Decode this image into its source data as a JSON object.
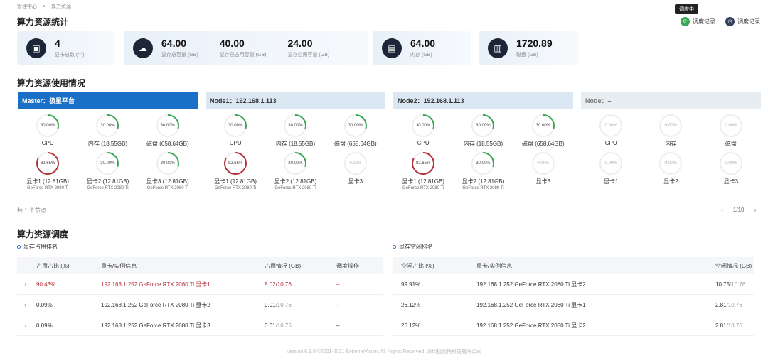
{
  "breadcrumb": [
    "管理中心",
    ">",
    "算力资源"
  ],
  "page_title": "算力资源统计",
  "tooltip": "调度中",
  "header_buttons": {
    "schedule_log_1": "调度记录",
    "schedule_log_2": "调度记录"
  },
  "stats": {
    "gpu_total": {
      "value": "4",
      "label": "显卡总数 (个)"
    },
    "mem_total": {
      "value": "64.00",
      "label": "显存总容量 (GB)"
    },
    "mem_used": {
      "value": "40.00",
      "label": "显存已占用容量 (GB)"
    },
    "mem_free": {
      "value": "24.00",
      "label": "显存空闲容量 (GB)"
    },
    "ram": {
      "value": "64.00",
      "label": "内存 (GB)"
    },
    "disk": {
      "value": "1720.89",
      "label": "磁盘 (GB)"
    }
  },
  "usage_title": "算力资源使用情况",
  "nodes": [
    {
      "title": "Master：极星平台",
      "state": "active",
      "gauges": [
        {
          "pct": 30,
          "text": "30.00%",
          "label": "CPU",
          "sub": ""
        },
        {
          "pct": 30,
          "text": "30.00%",
          "label": "内存 (18.55GB)",
          "sub": ""
        },
        {
          "pct": 30,
          "text": "30.00%",
          "label": "磁盘 (658.64GB)",
          "sub": ""
        },
        {
          "pct": 82.65,
          "text": "82.65%",
          "label": "显卡1 (12.81GB)",
          "sub": "GeForce RTX 2080 Ti"
        },
        {
          "pct": 30,
          "text": "30.00%",
          "label": "显卡2 (12.81GB)",
          "sub": "GeForce RTX 2080 Ti"
        },
        {
          "pct": 30,
          "text": "30.00%",
          "label": "显卡3 (12.81GB)",
          "sub": "GeForce RTX 2080 Ti"
        }
      ]
    },
    {
      "title": "Node1：192.168.1.113",
      "state": "normal",
      "gauges": [
        {
          "pct": 30,
          "text": "30.00%",
          "label": "CPU",
          "sub": ""
        },
        {
          "pct": 30,
          "text": "30.00%",
          "label": "内存 (18.55GB)",
          "sub": ""
        },
        {
          "pct": 30,
          "text": "30.00%",
          "label": "磁盘 (658.64GB)",
          "sub": ""
        },
        {
          "pct": 82.65,
          "text": "82.65%",
          "label": "显卡1 (12.81GB)",
          "sub": "GeForce RTX 2080 Ti"
        },
        {
          "pct": 30,
          "text": "30.00%",
          "label": "显卡2 (12.81GB)",
          "sub": "GeForce RTX 2080 Ti"
        },
        {
          "pct": 0,
          "text": "0.00%",
          "label": "显卡3",
          "sub": ""
        }
      ]
    },
    {
      "title": "Node2：192.168.1.113",
      "state": "normal",
      "gauges": [
        {
          "pct": 30,
          "text": "30.00%",
          "label": "CPU",
          "sub": ""
        },
        {
          "pct": 30,
          "text": "30.00%",
          "label": "内存 (18.55GB)",
          "sub": ""
        },
        {
          "pct": 30,
          "text": "30.00%",
          "label": "磁盘 (658.64GB)",
          "sub": ""
        },
        {
          "pct": 82.65,
          "text": "82.65%",
          "label": "显卡1 (12.81GB)",
          "sub": "GeForce RTX 2080 Ti"
        },
        {
          "pct": 30,
          "text": "30.00%",
          "label": "显卡2 (12.81GB)",
          "sub": "GeForce RTX 2080 Ti"
        },
        {
          "pct": 0,
          "text": "0.00%",
          "label": "显卡3",
          "sub": ""
        }
      ]
    },
    {
      "title": "Node：–",
      "state": "muted",
      "gauges": [
        {
          "pct": 0,
          "text": "0.00%",
          "label": "CPU",
          "sub": ""
        },
        {
          "pct": 0,
          "text": "0.00%",
          "label": "内存",
          "sub": ""
        },
        {
          "pct": 0,
          "text": "0.00%",
          "label": "磁盘",
          "sub": ""
        },
        {
          "pct": 0,
          "text": "0.00%",
          "label": "显卡1",
          "sub": ""
        },
        {
          "pct": 0,
          "text": "0.00%",
          "label": "显卡2",
          "sub": ""
        },
        {
          "pct": 0,
          "text": "0.00%",
          "label": "显卡3",
          "sub": ""
        }
      ]
    }
  ],
  "node_count": "共 1 个节点",
  "pager": {
    "prev": "‹",
    "page": "1/10",
    "next": "›"
  },
  "schedule_title": "算力资源调度",
  "used_rank": {
    "title": "显存占用排名",
    "headers": [
      "占用占比 (%)",
      "显卡/实例信息",
      "占用情况 (GB)",
      "调度操作"
    ],
    "rows": [
      {
        "pct": "90.43%",
        "info": "192.168.1.252 GeForce RTX 2080 Ti 显卡1",
        "used": "8.02",
        "total": "/10.76",
        "op": "–",
        "hot": true
      },
      {
        "pct": "0.09%",
        "info": "192.168.1.252 GeForce RTX 2080 Ti 显卡2",
        "used": "0.01",
        "total": "/10.76",
        "op": "–",
        "hot": false
      },
      {
        "pct": "0.09%",
        "info": "192.168.1.252 GeForce RTX 2080 Ti 显卡3",
        "used": "0.01",
        "total": "/10.76",
        "op": "–",
        "hot": false
      }
    ]
  },
  "free_rank": {
    "title": "显存空闲排名",
    "headers": [
      "空闲占比 (%)",
      "显卡/实例信息",
      "空闲情况 (GB)"
    ],
    "rows": [
      {
        "pct": "99.91%",
        "info": "192.168.1.252 GeForce RTX 2080 Ti 显卡2",
        "free": "10.75",
        "total": "/10.76"
      },
      {
        "pct": "26.12%",
        "info": "192.168.1.252 GeForce RTX 2080 Ti 显卡1",
        "free": "2.81",
        "total": "/10.76"
      },
      {
        "pct": "26.12%",
        "info": "192.168.1.252 GeForce RTX 2080 Ti 显卡2",
        "free": "2.81",
        "total": "/10.76"
      }
    ]
  },
  "footer": "Version 6.3.0 ©2001-2021 ExtremeVision. All Rights Reserved. 深圳极视角科技有限公司",
  "colors": {
    "ring_normal": "#3aa757",
    "ring_high": "#b5333b",
    "ring_track": "#eeeeee",
    "accent": "#1a6fc6"
  }
}
